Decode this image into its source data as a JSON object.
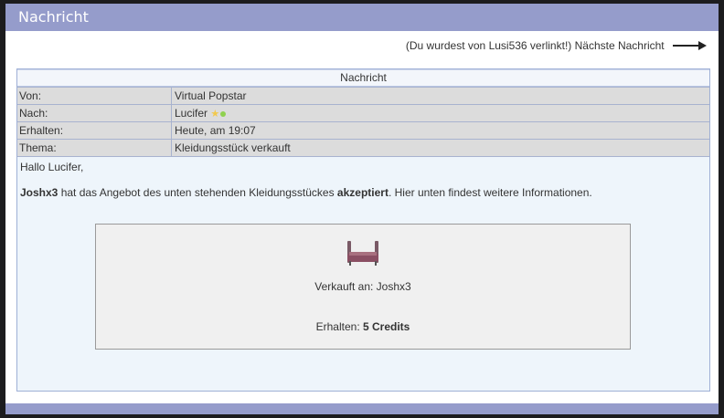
{
  "window": {
    "title": "Nachricht"
  },
  "nav": {
    "text": "(Du wurdest von Lusi536 verlinkt!) Nächste Nachricht"
  },
  "message": {
    "header": "Nachricht",
    "fields": [
      {
        "key": "Von:",
        "value": "Virtual Popstar"
      },
      {
        "key": "Nach:",
        "value": "Lucifer"
      },
      {
        "key": "Erhalten:",
        "value": "Heute, am 19:07"
      },
      {
        "key": "Thema:",
        "value": "Kleidungsstück verkauft"
      }
    ],
    "greeting": "Hallo Lucifer,",
    "body": {
      "buyer": "Joshx3",
      "part1": " hat das Angebot des unten stehenden Kleidungsstückes ",
      "accepted": "akzeptiert",
      "part2": ". Hier unten findest weitere Informationen."
    },
    "box": {
      "sold_label": "Verkauft an:",
      "sold_to": "Joshx3",
      "received_label": "Erhalten:",
      "received_value": "5 Credits"
    }
  },
  "icons": {
    "nav_arrow": "arrow-right-icon",
    "star": "star-icon",
    "status": "online-dot-icon",
    "item": "furniture-item-icon"
  },
  "colors": {
    "titlebar": "#959ccb",
    "panel_bg": "#eef5fb",
    "row_bg": "#dcdcdc"
  }
}
